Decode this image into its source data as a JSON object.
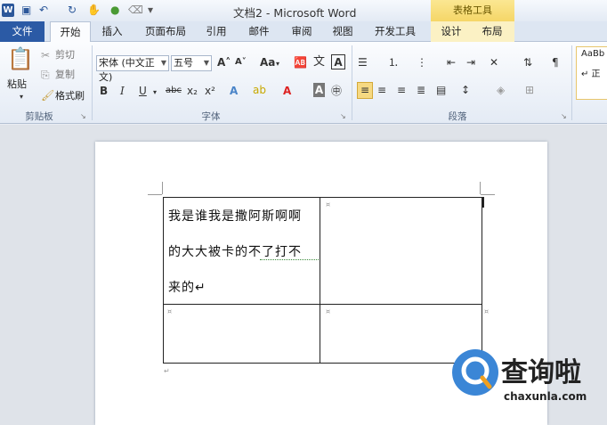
{
  "window": {
    "title": "文档2 - Microsoft Word",
    "contextual_tools": "表格工具"
  },
  "tabs": [
    "文件",
    "开始",
    "插入",
    "页面布局",
    "引用",
    "邮件",
    "审阅",
    "视图",
    "开发工具",
    "设计",
    "布局"
  ],
  "clipboard": {
    "paste": "粘贴",
    "cut": "剪切",
    "copy": "复制",
    "format_painter": "格式刷",
    "group_label": "剪贴板"
  },
  "font": {
    "name": "宋体 (中文正文)",
    "size": "五号",
    "group_label": "字体",
    "case_btn": "Aa"
  },
  "paragraph": {
    "group_label": "段落"
  },
  "styles": {
    "preview": "AaBb",
    "name": "↵ 正"
  },
  "document": {
    "lines": [
      "我是谁我是撒阿斯啊啊",
      "的大大被卡的不了打不",
      "来的↵"
    ]
  },
  "watermark": {
    "title": "查询啦",
    "url": "chaxunla.com"
  },
  "colors": {
    "file_tab": "#2b5aa5",
    "accent": "#2b579a",
    "tools": "#f5d667",
    "watermark": "#3b86d6"
  }
}
